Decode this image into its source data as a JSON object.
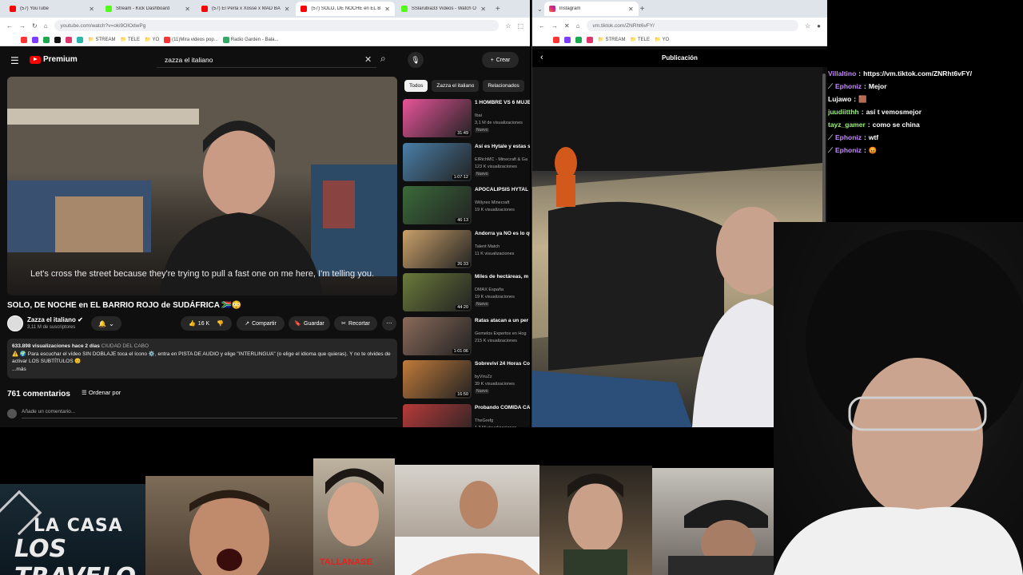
{
  "left_browser": {
    "tabs": [
      {
        "label": "(57) YouTube",
        "color": "#ff0000",
        "active": false
      },
      {
        "label": "Stream - Kick Dashboard",
        "color": "#53fc18",
        "active": false
      },
      {
        "label": "(57) El Perla x Xosse x MAD BA",
        "color": "#ff0000",
        "active": false
      },
      {
        "label": "(57) SOLO, DE NOCHE en EL B",
        "color": "#ff0000",
        "active": true
      },
      {
        "label": "SSlarubia33 Videos - Watch O",
        "color": "#53fc18",
        "active": false
      }
    ],
    "url": "youtube.com/watch?v=oki9OIOdwPg",
    "bookmarks": [
      "STREAM",
      "TELE",
      "YO",
      "(11)Mira videos pop...",
      "Radio Garden - Bala..."
    ]
  },
  "youtube": {
    "logo": "Premium",
    "search_value": "zazza el italiano",
    "create_label": "Crear",
    "subtitle": "Let's cross the street because they're trying to pull a fast one on me here, I'm telling you.",
    "title": "SOLO, DE NOCHE en EL BARRIO ROJO de SUDÁFRICA 🇿🇦😳",
    "channel": "Zazza el italiano",
    "subscribers": "3,11 M de suscriptores",
    "likes": "16 K",
    "share_label": "Compartir",
    "save_label": "Guardar",
    "clip_label": "Recortar",
    "views": "633.898 visualizaciones",
    "date": "hace 2 días",
    "location": "CIUDAD DEL CABO",
    "description": "⚠️ 🌍 Para escuchar el vídeo SIN DOBLAJE toca el ícono ⚙️, entra en PISTA DE AUDIO y elige \"INTERLINGUA\" (o elige el idioma que quieras). Y no te olvides de activar LOS SUBTÍTULOS 😊",
    "more_label": "...más",
    "comments_count": "761 comentarios",
    "sort_label": "Ordenar por",
    "comment_placeholder": "Añade un comentario...",
    "chips": [
      "Todos",
      "Zazza el italiano",
      "Relacionados"
    ],
    "recommendations": [
      {
        "title": "1 HOMBRE VS 6 MUJE",
        "channel": "Ibai",
        "views": "3,1 M de visualizaciones",
        "badge": "Nuevo",
        "duration": "31:49",
        "color": "#e8549a"
      },
      {
        "title": "Así es Hytale y estas s primeras impresiones",
        "channel": "ElRichMC - Minecraft & Ga",
        "views": "123 K visualizaciones",
        "badge": "Nuevo",
        "duration": "1:07:12",
        "color": "#4a7fa8"
      },
      {
        "title": "APOCALIPSIS HYTAL Leprechaun Vegetta!",
        "channel": "Willyrex Minecraft",
        "views": "19 K visualizaciones",
        "badge": "",
        "duration": "46:13",
        "color": "#3a6a3a"
      },
      {
        "title": "Andorra ya NO es lo qu Así vive la gente que f",
        "channel": "Talent Match",
        "views": "11 K visualizaciones",
        "badge": "",
        "duration": "26:33",
        "color": "#c9a06a"
      },
      {
        "title": "Miles de hectáreas, m juego: el imperio de la",
        "channel": "DMAX España",
        "views": "19 K visualizaciones",
        "badge": "Nuevo",
        "duration": "44:20",
        "color": "#6a7a3a"
      },
      {
        "title": "Ratas atacan a un per dueño de la casa... ¡Lo",
        "channel": "Gemelos Expertos en Hog",
        "views": "215 K visualizaciones",
        "badge": "",
        "duration": "1:01:06",
        "color": "#8a6a5a"
      },
      {
        "title": "Sobreviví 24 Horas Co Las Vegas",
        "channel": "byViruZz",
        "views": "39 K visualizaciones",
        "badge": "Nuevo",
        "duration": "16:50",
        "color": "#c07a3a"
      },
      {
        "title": "Probando COMIDA CA en PERÚ",
        "channel": "TheGrefg",
        "views": "1,3 M visualizaciones",
        "badge": "",
        "duration": "",
        "color": "#b83a3a"
      }
    ]
  },
  "right_browser": {
    "tab": "Instagram",
    "url": "vm.tiktok.com/ZNRht6vFY/",
    "bookmarks": [
      "STREAM",
      "TELE",
      "YO"
    ],
    "page_title": "Publicación"
  },
  "chat": [
    {
      "user": "Villaltino",
      "text": "https://vm.tiktok.com/ZNRht6vFY/",
      "color": "#c58af9",
      "badge": ""
    },
    {
      "user": "Ephoniz",
      "text": "Mejor",
      "color": "#c58af9",
      "badge": "sword"
    },
    {
      "user": "Lujawo",
      "text": "🟫",
      "color": "#ffffff",
      "badge": ""
    },
    {
      "user": "juudiitthh",
      "text": "así t vemosmejor",
      "color": "#9af07a",
      "badge": ""
    },
    {
      "user": "tayz_gamer",
      "text": "como se china",
      "color": "#9af07a",
      "badge": ""
    },
    {
      "user": "Ephoniz",
      "text": "wtf",
      "color": "#c58af9",
      "badge": "sword"
    },
    {
      "user": "Ephoniz",
      "text": "😡",
      "color": "#c58af9",
      "badge": "sword"
    }
  ],
  "overlay": {
    "logo_line1": "LA CASA",
    "logo_line2": "LOS TRAVELO",
    "clip_caption": "TALLANASE"
  }
}
